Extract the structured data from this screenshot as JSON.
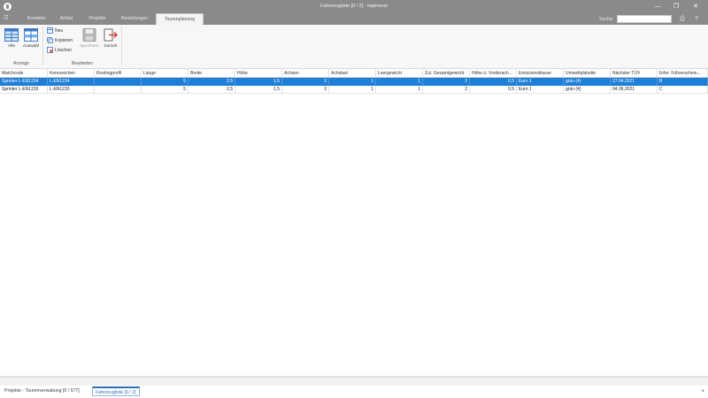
{
  "window": {
    "title": "Fahrzeugliste [0 / 2] - inpeneue",
    "controls": {
      "minimize": "—",
      "maximize": "❐",
      "close": "✕"
    }
  },
  "menubar": {
    "tabs": [
      "Kontakte",
      "Artikel",
      "Projekte",
      "Bestellungen",
      "Tourenplanung"
    ],
    "active_tab": "Tourenplanung",
    "search_label": "Suche:",
    "search_value": "",
    "icons": [
      "printer-icon",
      "help-icon"
    ]
  },
  "ribbon": {
    "anzeige": {
      "label": "Anzeige",
      "buttons": [
        "Alle",
        "Auswahl"
      ]
    },
    "bearbeiten": {
      "label": "Bearbeiten",
      "small_buttons": [
        "Neu",
        "Kopieren",
        "Löschen"
      ],
      "big_buttons": [
        "Speichern",
        "Zurück"
      ]
    }
  },
  "table": {
    "columns": [
      "Matchcode",
      "Kennzeichen",
      "Routingprofil",
      "Länge",
      "Breite",
      "Höhe",
      "Achsen",
      "Achslast",
      "Leergewicht",
      "Zul. Gesamtgewicht",
      "Höhe ü. Vorderach...",
      "Emissionsklasse",
      "Umweltplakette",
      "Nächster TÜV",
      "Erfor. Führerschein..."
    ],
    "rows": [
      [
        "Sprinter L-EN1234",
        "L-EN1234",
        "",
        "5",
        "2,5",
        "1,5",
        "2",
        "1",
        "1",
        "2",
        "0,5",
        "Euro 1",
        "grün (4)",
        "27.04.2021",
        "B"
      ],
      [
        "Sprinter L-EN1233",
        "L-EN1233",
        "",
        "5",
        "2,5",
        "1,5",
        "2",
        "1",
        "1",
        "2",
        "0,5",
        "Euro 1",
        "grün (4)",
        "04.06.2021",
        "C"
      ]
    ],
    "selected_row": 0
  },
  "bottom_tabs": [
    "Projekte - Tourenverwaltung [0 / 577]",
    "Fahrzeugliste [0 / 2]"
  ],
  "active_bottom_tab": 1,
  "colors": {
    "titlebar": "#8a8a8a",
    "selection": "#1e7fd8",
    "active_tab_text": "#2a6fb8"
  }
}
